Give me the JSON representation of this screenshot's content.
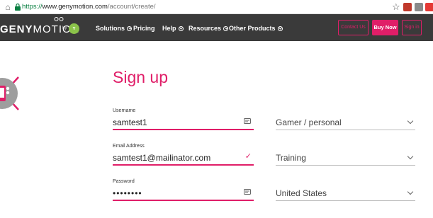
{
  "browser": {
    "url_scheme": "https://",
    "url_host": "www.genymotion.com",
    "url_path": "/account/create/"
  },
  "header": {
    "logo_bold": "GENY",
    "logo_light": "MOTION",
    "logo_by": "by",
    "nav": [
      {
        "label": "Solutions",
        "has_dropdown": true
      },
      {
        "label": "Pricing",
        "has_dropdown": false
      },
      {
        "label": "Help",
        "has_dropdown": true
      },
      {
        "label": "Resources",
        "has_dropdown": true
      },
      {
        "label": "Other Products",
        "has_dropdown": true
      }
    ],
    "contact_label": "Contact Us",
    "buy_label": "Buy Now",
    "signin_label": "Sign in"
  },
  "form": {
    "title": "Sign up",
    "username_label": "Username",
    "username_value": "samtest1",
    "email_label": "Email Address",
    "email_value": "samtest1@mailinator.com",
    "password_label": "Password",
    "password_value": "••••••••",
    "usage_value": "Gamer / personal",
    "company_value": "Training",
    "country_value": "United States"
  },
  "colors": {
    "accent": "#e01e68",
    "header_bg": "#3a3a3a"
  },
  "icons": {
    "home": "home-icon",
    "lock": "lock-icon",
    "star": "bookmark-star-icon",
    "autofill": "autofill-card-icon",
    "check": "check-icon",
    "caret": "chevron-down-icon"
  }
}
